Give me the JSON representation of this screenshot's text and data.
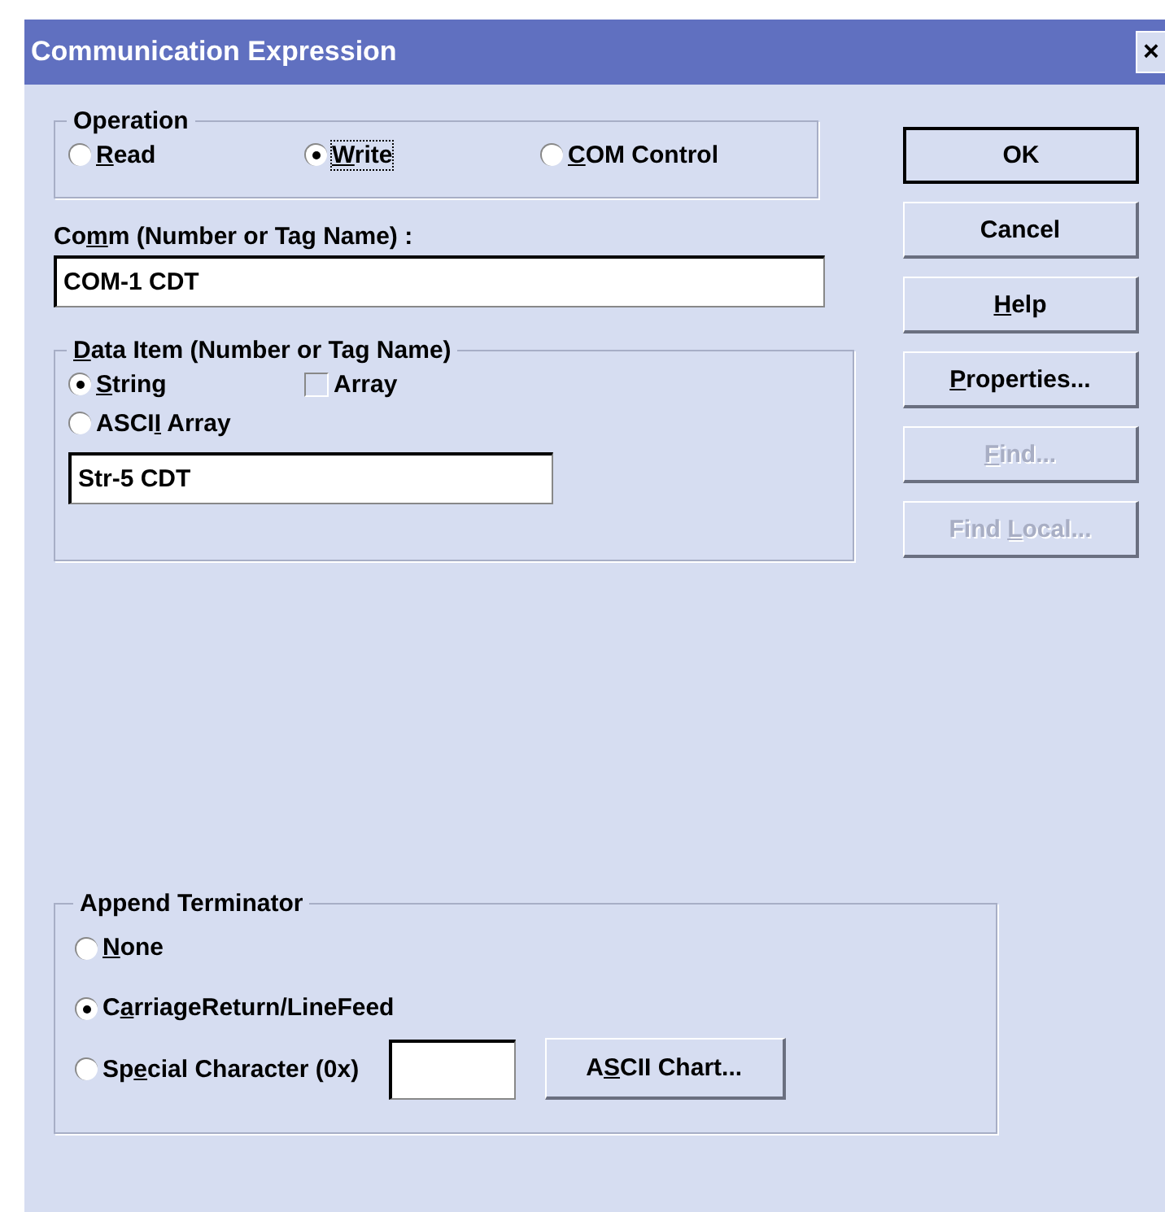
{
  "window": {
    "title": "Communication Expression",
    "close": "×"
  },
  "operation": {
    "label": "Operation",
    "options": [
      {
        "label": {
          "key": "R",
          "post": "ead"
        },
        "selected": false,
        "focused": false
      },
      {
        "label": {
          "key": "W",
          "post": "rite"
        },
        "selected": true,
        "focused": true
      },
      {
        "label": {
          "key": "C",
          "post": "OM Control"
        },
        "selected": false,
        "focused": false
      }
    ]
  },
  "comm": {
    "label": {
      "pre": "Co",
      "key": "m",
      "post": "m (Number or Tag Name) :"
    },
    "value": "COM-1 CDT"
  },
  "data_item": {
    "label": {
      "key": "D",
      "post": "ata Item (Number or Tag Name)"
    },
    "options": [
      {
        "label": {
          "key": "S",
          "post": "tring"
        },
        "selected": true
      },
      {
        "label": {
          "pre": "ASCI",
          "key": "I",
          "post": " Array"
        },
        "selected": false
      }
    ],
    "array_checkbox": {
      "label": {
        "post": "Array"
      },
      "checked": false
    },
    "value": "Str-5 CDT"
  },
  "append_terminator": {
    "label": "Append Terminator",
    "options": [
      {
        "label": {
          "key": "N",
          "post": "one"
        },
        "selected": false
      },
      {
        "label": {
          "pre": "C",
          "key": "a",
          "post": "rriageReturn/LineFeed"
        },
        "selected": true
      },
      {
        "label": {
          "pre": "Sp",
          "key": "e",
          "post": "cial Character (0x)"
        },
        "selected": false
      }
    ],
    "ascii_chart_button": {
      "label": {
        "pre": "A",
        "key": "S",
        "post": "CII Chart..."
      }
    }
  },
  "buttons": [
    {
      "label": {
        "post": "OK"
      },
      "default": true,
      "disabled": false
    },
    {
      "label": {
        "post": "Cancel"
      },
      "default": false,
      "disabled": false
    },
    {
      "label": {
        "key": "H",
        "post": "elp"
      },
      "default": false,
      "disabled": false
    },
    {
      "label": {
        "key": "P",
        "post": "roperties..."
      },
      "default": false,
      "disabled": false
    },
    {
      "label": {
        "key": "F",
        "post": "ind..."
      },
      "default": false,
      "disabled": true
    },
    {
      "label": {
        "pre": "Find ",
        "key": "L",
        "post": "ocal..."
      },
      "default": false,
      "disabled": true
    }
  ]
}
